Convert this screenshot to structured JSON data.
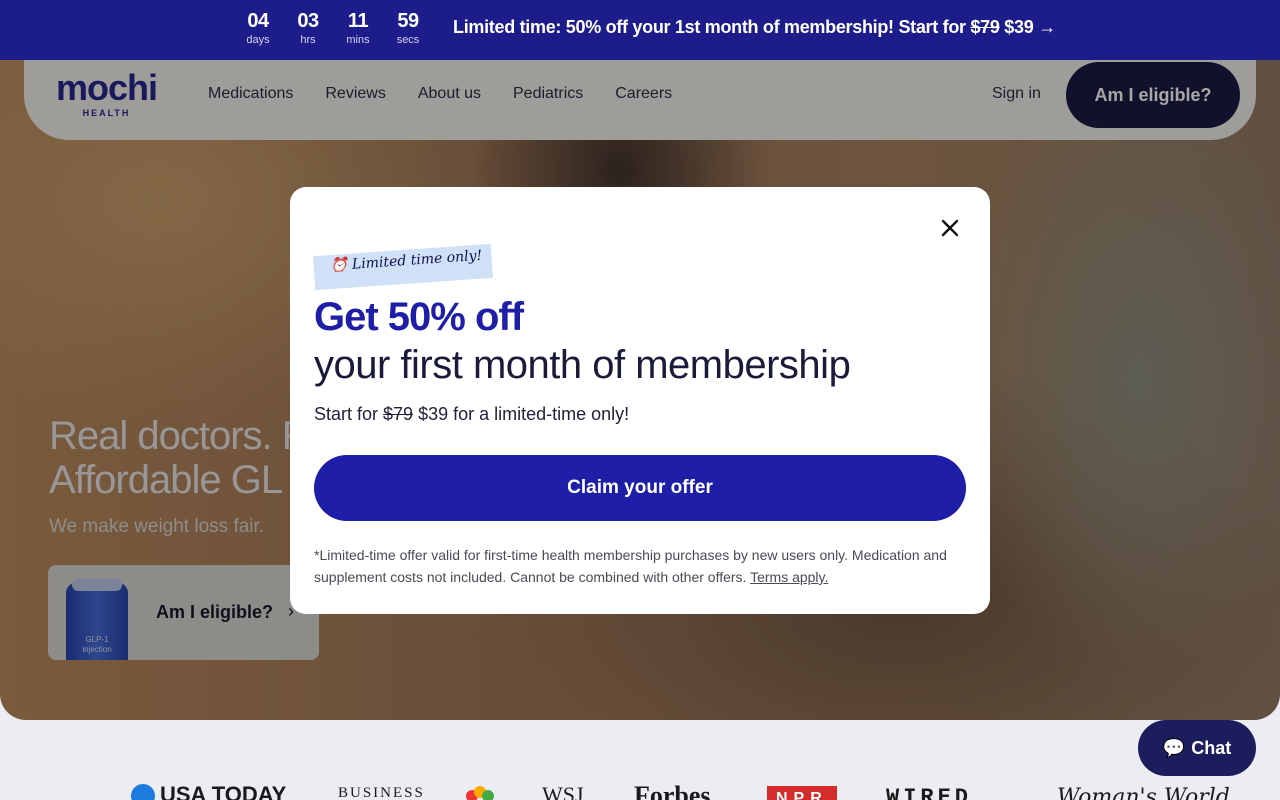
{
  "banner": {
    "countdown": [
      {
        "value": "04",
        "label": "days"
      },
      {
        "value": "03",
        "label": "hrs"
      },
      {
        "value": "11",
        "label": "mins"
      },
      {
        "value": "59",
        "label": "secs"
      }
    ],
    "promo_prefix": "Limited time: 50% off your 1st month of membership! Start for ",
    "promo_old_price": "$79",
    "promo_new_price": " $39 →"
  },
  "nav": {
    "logo_word": "mochi",
    "logo_sub": "HEALTH",
    "links": [
      "Medications",
      "Reviews",
      "About us",
      "Pediatrics",
      "Careers"
    ],
    "sign_in": "Sign in",
    "eligible": "Am I eligible?"
  },
  "hero": {
    "headline_line1": "Real doctors. R",
    "headline_line2": "Affordable GL",
    "subtitle": "We make weight loss fair.",
    "card_label": "Am I eligible?",
    "card_chevron": "›",
    "vial_text_1": "GLP-1",
    "vial_text_2": "injection"
  },
  "press": [
    "USA TODAY",
    "BUSINESS",
    "WSJ",
    "Forbes",
    "NPR",
    "WIRED",
    "Woman's World"
  ],
  "chat": {
    "label": "Chat"
  },
  "modal": {
    "ribbon": "⏰ Limited time only!",
    "headline": "Get 50% off",
    "subheadline": "your first month of membership",
    "start_prefix": "Start for ",
    "start_old": "$79",
    "start_suffix": " $39 for a limited-time only!",
    "cta": "Claim your offer",
    "fine_print": "*Limited-time offer valid for first-time health membership purchases by new users only. Medication and supplement costs not included. Cannot be combined with other offers. ",
    "terms": "Terms apply."
  }
}
